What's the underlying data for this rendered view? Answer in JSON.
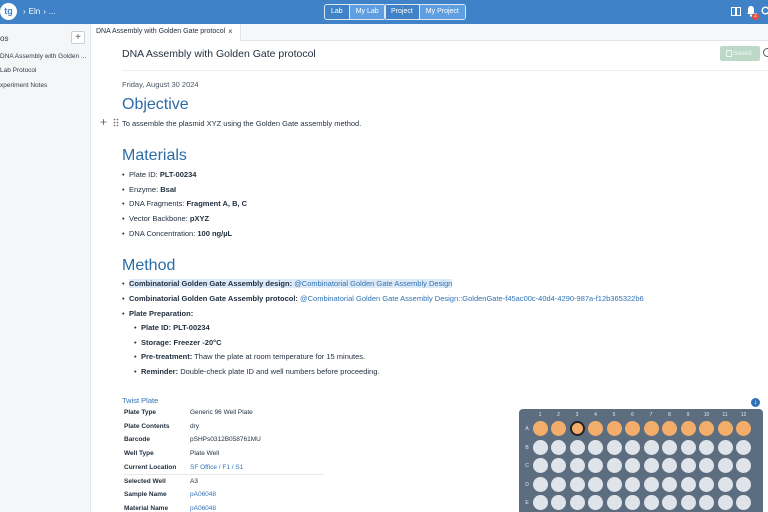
{
  "topbar": {
    "logo": "tg",
    "breadcrumb": [
      "Eln",
      "..."
    ],
    "lab_switch": {
      "options": [
        "Lab",
        "My Lab"
      ],
      "active": 1
    },
    "project_switch": {
      "options": [
        "Project",
        "My Project"
      ],
      "active": 1
    },
    "notification_count": "2",
    "icons": [
      "book-icon",
      "bell-icon",
      "search-icon"
    ]
  },
  "sidebar": {
    "title": "os",
    "add_label": "+",
    "items": [
      {
        "label": "DNA Assembly with Golden ..."
      },
      {
        "label": "Lab Protocol"
      },
      {
        "label": "xperiment Notes"
      }
    ]
  },
  "tab": {
    "label": "DNA Assembly with Golden Gate protocol",
    "close": "×"
  },
  "document": {
    "title": "DNA Assembly with Golden Gate protocol",
    "saved_label": "Saved",
    "date": "Friday, August 30 2024",
    "objective": {
      "heading": "Objective",
      "text": "To assemble the plasmid XYZ using the Golden Gate assembly method."
    },
    "materials": {
      "heading": "Materials",
      "items": [
        {
          "label": "Plate ID: ",
          "value": "PLT-00234"
        },
        {
          "label": "Enzyme: ",
          "value": "BsaI"
        },
        {
          "label": "DNA Fragments: ",
          "value": "Fragment A, B, C"
        },
        {
          "label": "Vector Backbone: ",
          "value": "pXYZ"
        },
        {
          "label": "DNA Concentration: ",
          "value": "100 ng/µL"
        }
      ]
    },
    "method": {
      "heading": "Method",
      "items": [
        {
          "label": "Combinatorial Golden Gate Assembly design:",
          "link": "@Combinatorial Golden Gate Assembly Design"
        },
        {
          "label": "Combinatorial Golden Gate Assembly protocol:",
          "link": "@Combinatorial Golden Gate Assembly Design::GoldenGate-f45ac00c-40d4-4290-987a-f12b365322b6"
        },
        {
          "label": "Plate Preparation:"
        }
      ],
      "sub_items": [
        {
          "label": "Plate ID: PLT-00234",
          "text": ""
        },
        {
          "label": "Storage: Freezer -20°C",
          "text": ""
        },
        {
          "label": "Pre-treatment:",
          "text": "Thaw the plate at room temperature for 15 minutes."
        },
        {
          "label": "Reminder:",
          "text": "Double-check plate ID and well numbers before proceeding."
        }
      ]
    }
  },
  "plate_details": {
    "link": "Twist Plate",
    "rows": [
      {
        "key": "Plate Type",
        "value": "Generic 96 Well Plate"
      },
      {
        "key": "Plate Contents",
        "value": "dry"
      },
      {
        "key": "Barcode",
        "value": "pSHPs0312B058761MU"
      },
      {
        "key": "Well Type",
        "value": "Plate Well"
      },
      {
        "key": "Current Location",
        "value": "SF Office / F1 / S1"
      },
      {
        "key": "Selected Well",
        "value": "A3"
      },
      {
        "key": "Sample Name",
        "value": "pA06048"
      },
      {
        "key": "Material Name",
        "value": "pA06048"
      }
    ]
  },
  "well_plate": {
    "columns": [
      "1",
      "2",
      "3",
      "4",
      "5",
      "6",
      "7",
      "8",
      "9",
      "10",
      "11",
      "12"
    ],
    "rows": [
      "A",
      "B",
      "C",
      "D",
      "E"
    ],
    "filled_rows": [
      "A"
    ],
    "selected_well": "A3",
    "colors": {
      "filled": "#f3ad6b",
      "empty": "#dfe3ea",
      "plate": "#5d6d80"
    }
  },
  "colors": {
    "topbar": "#3f82c7",
    "heading": "#2b6ca8",
    "link": "#2f73b5"
  }
}
